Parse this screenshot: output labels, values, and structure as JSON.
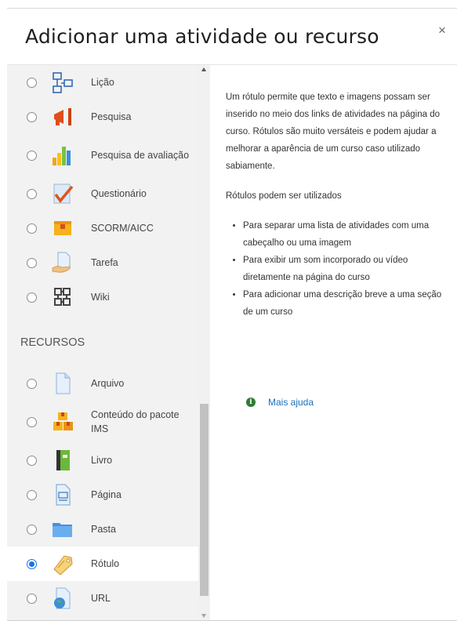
{
  "dialog": {
    "title": "Adicionar uma atividade ou recurso",
    "close_symbol": "×"
  },
  "section_heading": "RECURSOS",
  "activities": [
    {
      "label": "Lição",
      "icon": "lesson-icon",
      "checked": false
    },
    {
      "label": "Pesquisa",
      "icon": "survey-megaphone-icon",
      "checked": false
    },
    {
      "label": "Pesquisa de avaliação",
      "icon": "feedback-chart-icon",
      "checked": false
    },
    {
      "label": "Questionário",
      "icon": "quiz-check-icon",
      "checked": false
    },
    {
      "label": "SCORM/AICC",
      "icon": "scorm-package-icon",
      "checked": false
    },
    {
      "label": "Tarefa",
      "icon": "assignment-hand-icon",
      "checked": false
    },
    {
      "label": "Wiki",
      "icon": "wiki-icon",
      "checked": false
    }
  ],
  "resources": [
    {
      "label": "Arquivo",
      "icon": "file-icon",
      "checked": false
    },
    {
      "label": "Conteúdo do pacote IMS",
      "icon": "ims-package-icon",
      "checked": false
    },
    {
      "label": "Livro",
      "icon": "book-icon",
      "checked": false
    },
    {
      "label": "Página",
      "icon": "page-icon",
      "checked": false
    },
    {
      "label": "Pasta",
      "icon": "folder-icon",
      "checked": false
    },
    {
      "label": "Rótulo",
      "icon": "label-tag-icon",
      "checked": true
    },
    {
      "label": "URL",
      "icon": "url-globe-icon",
      "checked": false
    }
  ],
  "description": {
    "paragraph1": "Um rótulo permite que texto e imagens possam ser inserido no meio dos links de atividades na página do curso. Rótulos são muito versáteis e podem ajudar a melhorar a aparência de um curso caso utilizado sabiamente.",
    "paragraph2": "Rótulos podem ser utilizados",
    "bullets": [
      "Para separar uma lista de atividades com uma cabeçalho ou uma imagem",
      "Para exibir um som incorporado ou vídeo diretamente na página do curso",
      "Para adicionar uma descrição breve a uma seção de um curso"
    ],
    "help_link": "Mais ajuda"
  },
  "colors": {
    "accent": "#1a73e8",
    "link": "#1a6fb8",
    "help_icon": "#2e7d32",
    "list_background": "#f2f2f2"
  }
}
